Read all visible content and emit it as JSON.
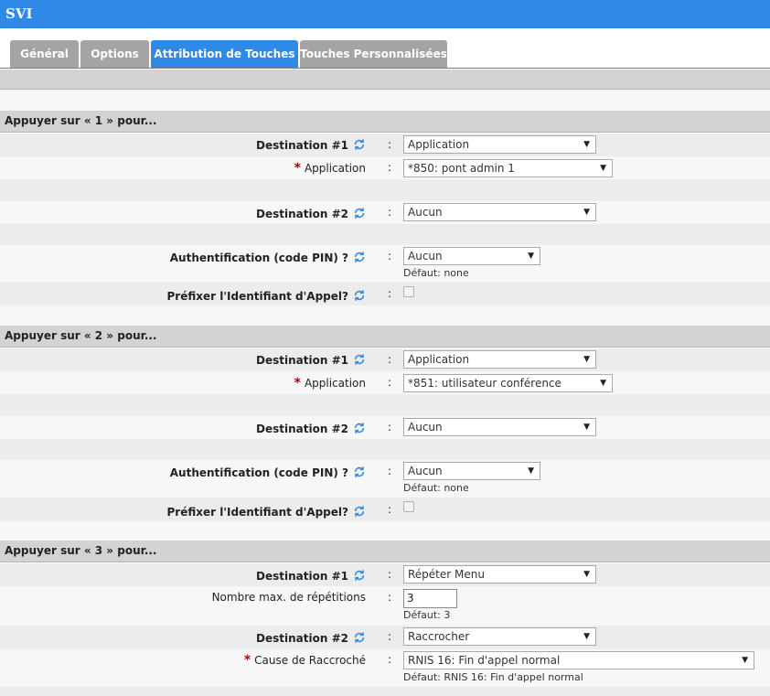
{
  "app": {
    "title": "SVI"
  },
  "tabs": [
    {
      "label": "Général"
    },
    {
      "label": "Options"
    },
    {
      "label": "Attribution de Touches"
    },
    {
      "label": "Touches Personnalisées"
    }
  ],
  "colors": {
    "accent": "#2e8ae6",
    "tab_inactive": "#a4a4a4",
    "required": "#b20000"
  },
  "common": {
    "colon": ":",
    "required_mark": "*",
    "refresh_icon": "refresh-icon",
    "default_none": "Défaut: none"
  },
  "sections": [
    {
      "header": "Appuyer sur « 1 » pour...",
      "dest1_label": "Destination #1",
      "dest1_value": "Application",
      "app_label": "Application",
      "app_value": "*850: pont admin 1",
      "dest2_label": "Destination #2",
      "dest2_value": "Aucun",
      "auth_label": "Authentification (code PIN) ?",
      "auth_value": "Aucun",
      "prefix_label": "Préfixer l'Identifiant d'Appel?",
      "prefix_checked": false
    },
    {
      "header": "Appuyer sur « 2 » pour...",
      "dest1_label": "Destination #1",
      "dest1_value": "Application",
      "app_label": "Application",
      "app_value": "*851: utilisateur conférence",
      "dest2_label": "Destination #2",
      "dest2_value": "Aucun",
      "auth_label": "Authentification (code PIN) ?",
      "auth_value": "Aucun",
      "prefix_label": "Préfixer l'Identifiant d'Appel?",
      "prefix_checked": false
    },
    {
      "header": "Appuyer sur « 3 » pour...",
      "dest1_label": "Destination #1",
      "dest1_value": "Répéter Menu",
      "maxrep_label": "Nombre max. de répétitions",
      "maxrep_value": "3",
      "maxrep_default": "Défaut: 3",
      "dest2_label": "Destination #2",
      "dest2_value": "Raccrocher",
      "cause_label": "Cause de Raccroché",
      "cause_value": "RNIS 16: Fin d'appel normal",
      "cause_default": "Défaut: RNIS 16: Fin d'appel normal"
    }
  ]
}
